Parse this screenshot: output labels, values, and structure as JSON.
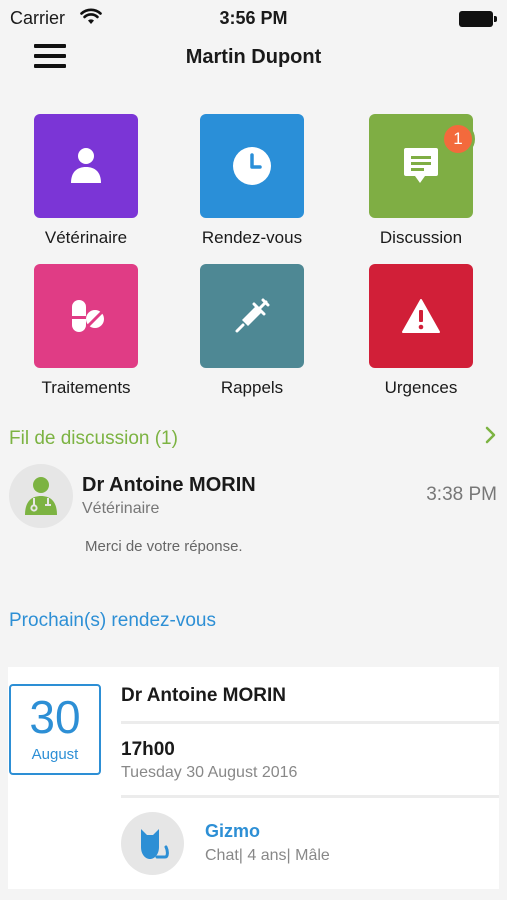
{
  "status_bar": {
    "carrier": "Carrier",
    "time": "3:56 PM"
  },
  "nav": {
    "title": "Martin Dupont"
  },
  "tiles": [
    {
      "label": "Vétérinaire",
      "color": "#7b35d6",
      "icon": "user-icon"
    },
    {
      "label": "Rendez-vous",
      "color": "#2a8fd8",
      "icon": "clock-icon"
    },
    {
      "label": "Discussion",
      "color": "#7fae44",
      "icon": "chat-icon",
      "badge": "1"
    },
    {
      "label": "Traitements",
      "color": "#e03c85",
      "icon": "pills-icon"
    },
    {
      "label": "Rappels",
      "color": "#4e8894",
      "icon": "syringe-icon"
    },
    {
      "label": "Urgences",
      "color": "#d11f38",
      "icon": "warning-icon"
    }
  ],
  "discussion": {
    "header": "Fil de discussion (1)",
    "doctor_name": "Dr Antoine MORIN",
    "doctor_role": "Vétérinaire",
    "time": "3:38 PM",
    "preview": "Merci de votre réponse."
  },
  "appointments": {
    "header": "Prochain(s) rendez-vous",
    "day": "30",
    "month": "August",
    "doctor": "Dr Antoine MORIN",
    "time": "17h00",
    "date": "Tuesday 30 August 2016",
    "pet_name": "Gizmo",
    "pet_info": "Chat| 4 ans| Mâle"
  },
  "colors": {
    "accent_blue": "#2d8fd5",
    "accent_green": "#7cb342",
    "badge": "#f36a3c"
  }
}
